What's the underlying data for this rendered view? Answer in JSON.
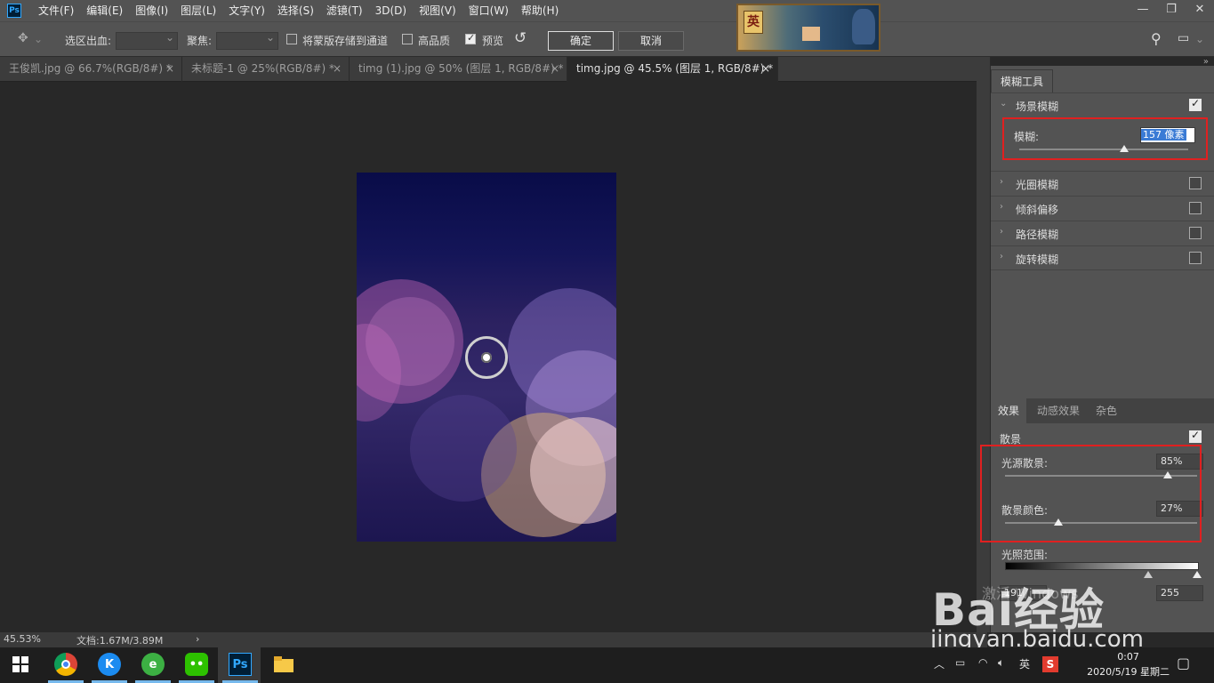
{
  "menubar": {
    "logo": "Ps",
    "items": [
      "文件(F)",
      "编辑(E)",
      "图像(I)",
      "图层(L)",
      "文字(Y)",
      "选择(S)",
      "滤镜(T)",
      "3D(D)",
      "视图(V)",
      "窗口(W)",
      "帮助(H)"
    ],
    "window_controls": [
      "—",
      "❐",
      "✕"
    ]
  },
  "options": {
    "selection_bleed_label": "选区出血:",
    "focus_label": "聚焦:",
    "save_mask_label": "将蒙版存储到通道",
    "save_mask_checked": false,
    "high_quality_label": "高品质",
    "high_quality_checked": false,
    "preview_label": "预览",
    "preview_checked": true,
    "ok_label": "确定",
    "cancel_label": "取消"
  },
  "tabs": [
    {
      "label": "王俊凯.jpg @ 66.7%(RGB/8#) *",
      "close": "×"
    },
    {
      "label": "未标题-1 @ 25%(RGB/8#) *",
      "close": "×"
    },
    {
      "label": "timg (1).jpg @ 50% (图层 1, RGB/8#) *",
      "close": "×"
    },
    {
      "label": "timg.jpg @ 45.5% (图层 1, RGB/8#) *",
      "close": "×"
    }
  ],
  "status": {
    "zoom": "45.53%",
    "doc_info": "文档:1.67M/3.89M",
    "arrow": "›"
  },
  "blur_panel": {
    "tab_label": "模糊工具",
    "field_blur": {
      "label": "场景模糊",
      "checked": true
    },
    "blur_amount_label": "模糊:",
    "blur_amount_value": "157 像素",
    "blur_amount_fraction": 0.79,
    "sections": [
      {
        "label": "光圈模糊",
        "checked": false
      },
      {
        "label": "倾斜偏移",
        "checked": false
      },
      {
        "label": "路径模糊",
        "checked": false
      },
      {
        "label": "旋转模糊",
        "checked": false
      }
    ]
  },
  "effects_panel": {
    "tabs": [
      "效果",
      "动感效果",
      "杂色"
    ],
    "bokeh_label": "散景",
    "bokeh_checked": true,
    "light_bokeh_label": "光源散景:",
    "light_bokeh_value": "85%",
    "light_bokeh_fraction": 0.85,
    "bokeh_color_label": "散景颜色:",
    "bokeh_color_value": "27%",
    "bokeh_color_fraction": 0.27,
    "light_range_label": "光照范围:",
    "light_range_low": "191",
    "light_range_high": "255"
  },
  "watermark": {
    "brand": "Bai经验",
    "windows_hint": "激活 Windows",
    "url": "jingyan.baidu.com"
  },
  "taskbar": {
    "apps": [
      "chrome-icon",
      "kugou-icon",
      "360-browser-icon",
      "wechat-icon",
      "photoshop-icon",
      "file-explorer-icon"
    ],
    "ps_label": "Ps",
    "kugou_label": "K",
    "ime": "英",
    "time": "0:07",
    "date": "2020/5/19 星期二"
  },
  "colors": {
    "accent_red": "#e02020",
    "ps_blue": "#31a8ff"
  }
}
